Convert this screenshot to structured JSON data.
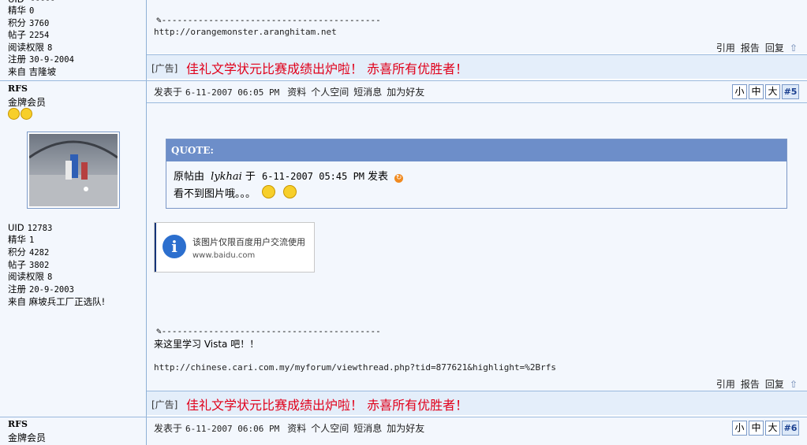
{
  "post_top": {
    "user": {
      "stats": [
        {
          "label": "精华",
          "value": "0"
        },
        {
          "label": "积分",
          "value": "3760"
        },
        {
          "label": "帖子",
          "value": "2254"
        },
        {
          "label": "阅读权限",
          "value": "8"
        },
        {
          "label": "注册",
          "value": "30-9-2004"
        },
        {
          "label": "来自",
          "value": "吉隆坡"
        }
      ]
    },
    "signature_line": "✎------------------------------------------",
    "signature_url": "http://orangemonster.aranghitam.net"
  },
  "actions": {
    "quote": "引用",
    "report": "报告",
    "reply": "回复",
    "top": "⇧"
  },
  "ad": {
    "tag": "[广告]",
    "text": "佳礼文学状元比赛成绩出炉啦！ 赤喜所有优胜者！"
  },
  "post5": {
    "user": {
      "name": "RFS",
      "rank": "金牌会员",
      "stats": [
        {
          "label": "UID",
          "value": "12783"
        },
        {
          "label": "精华",
          "value": "1"
        },
        {
          "label": "积分",
          "value": "4282"
        },
        {
          "label": "帖子",
          "value": "3802"
        },
        {
          "label": "阅读权限",
          "value": "8"
        },
        {
          "label": "注册",
          "value": "20-9-2003"
        },
        {
          "label": "来自",
          "value": "麻坡兵工厂正选队!"
        }
      ]
    },
    "meta": {
      "posted_label": "发表于",
      "timestamp": "6-11-2007 06:05 PM",
      "links": [
        "资料",
        "个人空间",
        "短消息",
        "加为好友"
      ]
    },
    "size_buttons": [
      "小",
      "中",
      "大"
    ],
    "post_number": "#5",
    "quote": {
      "header": "QUOTE:",
      "origin_prefix": "原帖由",
      "origin_user": "lykhai",
      "origin_at": "于",
      "origin_time": "6-11-2007 05:45 PM",
      "origin_suffix": "发表",
      "text": "看不到图片哦。。。"
    },
    "baidu": {
      "line1": "该图片仅限百度用户交流使用",
      "line2": "www.baidu.com"
    },
    "signature_line": "✎------------------------------------------",
    "signature_text": "来这里学习 Vista 吧！！",
    "signature_url": "http://chinese.cari.com.my/myforum/viewthread.php?tid=877621&highlight=%2Brfs"
  },
  "post6": {
    "user": {
      "name": "RFS",
      "rank": "金牌会员"
    },
    "meta": {
      "posted_label": "发表于",
      "timestamp": "6-11-2007 06:06 PM",
      "links": [
        "资料",
        "个人空间",
        "短消息",
        "加为好友"
      ]
    },
    "size_buttons": [
      "小",
      "中",
      "大"
    ],
    "post_number": "#6"
  },
  "colors": {
    "ad_red": "#e0001a",
    "quote_header": "#6d8ec9",
    "border": "#9ab9dd"
  }
}
